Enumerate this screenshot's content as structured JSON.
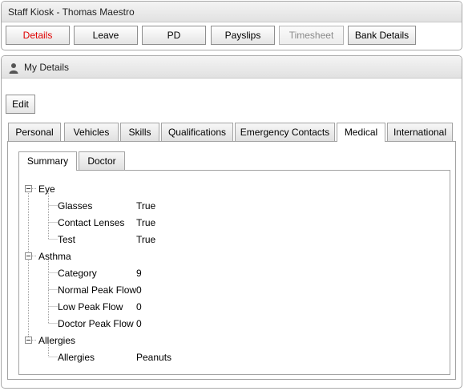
{
  "header": {
    "title": "Staff Kiosk - Thomas Maestro"
  },
  "nav": {
    "details": "Details",
    "leave": "Leave",
    "pd": "PD",
    "payslips": "Payslips",
    "timesheet": "Timesheet",
    "bank_details": "Bank Details"
  },
  "my_details": {
    "title": "My Details",
    "edit_label": "Edit"
  },
  "tabs": {
    "personal": "Personal",
    "vehicles": "Vehicles",
    "skills": "Skills",
    "qualifications": "Qualifications",
    "emergency_contacts": "Emergency Contacts",
    "medical": "Medical",
    "international": "International",
    "selected": "Medical"
  },
  "subtabs": {
    "summary": "Summary",
    "doctor": "Doctor",
    "selected": "Summary"
  },
  "tree": {
    "eye": {
      "label": "Eye",
      "glasses": {
        "label": "Glasses",
        "value": "True"
      },
      "contact_lenses": {
        "label": "Contact Lenses",
        "value": "True"
      },
      "test": {
        "label": "Test",
        "value": "True"
      }
    },
    "asthma": {
      "label": "Asthma",
      "category": {
        "label": "Category",
        "value": "9"
      },
      "normal_peak_flow": {
        "label": "Normal Peak Flow",
        "value": "0"
      },
      "low_peak_flow": {
        "label": "Low Peak Flow",
        "value": "0"
      },
      "doctor_peak_flow": {
        "label": "Doctor Peak Flow",
        "value": "0"
      }
    },
    "allergies": {
      "label": "Allergies",
      "allergies": {
        "label": "Allergies",
        "value": "Peanuts"
      }
    }
  },
  "colors": {
    "active_nav": "#e00000",
    "disabled_text": "#8a8a8a",
    "panel_header": "#e8e8e8"
  },
  "icons": {
    "header": "person-icon",
    "expand": "minus-box-icon"
  }
}
